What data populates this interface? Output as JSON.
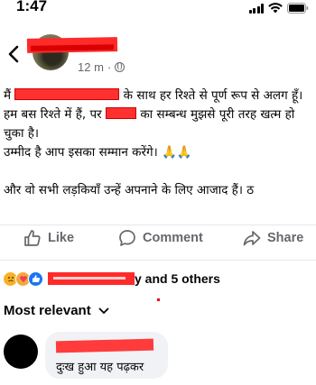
{
  "status_bar": {
    "time": "1:47",
    "icons": [
      "cellular-signal-icon",
      "wifi-icon",
      "battery-icon"
    ]
  },
  "post": {
    "author_name_redacted": true,
    "time_ago": "12 m",
    "separator": "·",
    "privacy_icon": "globe-icon",
    "paragraphs": {
      "p1_prefix": "मैं",
      "p1_mid": "के साथ हर रिश्ते से पूर्ण रूप से अलग हूँ। हम बस रिश्ते में हैं, पर",
      "p1_suffix": "का सम्बन्ध मुझसे पूरी तरह खत्म हो चुका है।",
      "p1_line2": "उम्मीद है आप इसका सम्मान करेंगे। 🙏🙏",
      "p2": "और वो सभी लड़कियाँ उन्हें अपनाने के लिए आजाद हैं। ठ"
    }
  },
  "actions": {
    "like": "Like",
    "comment": "Comment",
    "share": "Share"
  },
  "reactions": {
    "icons": [
      "sad-reaction-icon",
      "care-reaction-icon",
      "like-reaction-icon"
    ],
    "others_text": "y and 5 others"
  },
  "comments": {
    "sort_label": "Most relevant",
    "items": [
      {
        "text": "दुःख हुआ यह पढ़कर"
      }
    ]
  },
  "colors": {
    "redaction": "#ff2a2a",
    "meta_text": "#65676b",
    "like_blue": "#1877f2",
    "bubble_bg": "#f0f2f5"
  }
}
